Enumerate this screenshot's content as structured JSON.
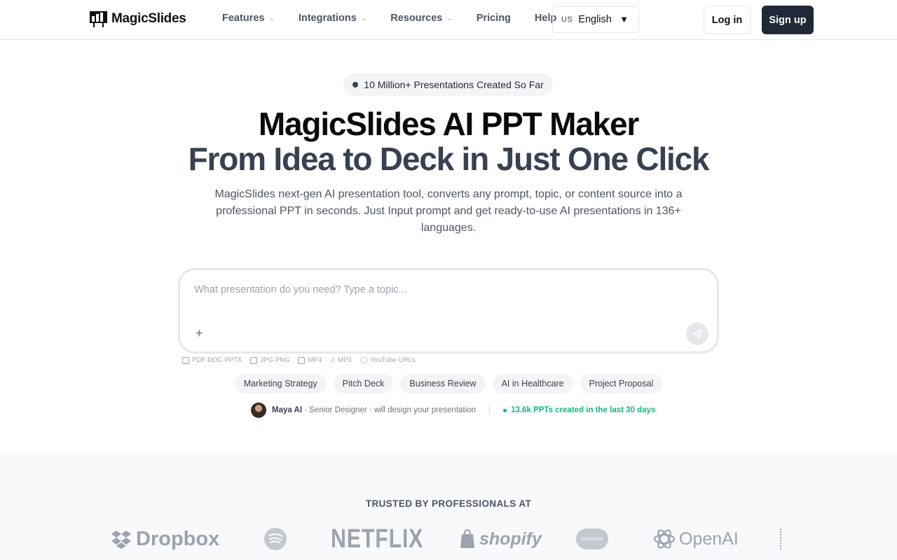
{
  "nav": {
    "brand": "MagicSlides",
    "links": [
      {
        "label": "Features",
        "has_menu": true
      },
      {
        "label": "Integrations",
        "has_menu": true
      },
      {
        "label": "Resources",
        "has_menu": true
      },
      {
        "label": "Pricing",
        "has_menu": false
      },
      {
        "label": "Help",
        "has_menu": false
      }
    ],
    "language": {
      "flag": "US",
      "label": "English"
    },
    "login": "Log in",
    "signup": "Sign up"
  },
  "hero": {
    "badge": "10 Million+ Presentations Created So Far",
    "title_line1": "MagicSlides AI PPT Maker",
    "title_line2": "From Idea to Deck in Just One Click",
    "subtitle": "MagicSlides next-gen AI presentation tool, converts any prompt, topic, or content source into a professional PPT in seconds. Just Input prompt and get ready-to-use AI presentations in 136+ languages."
  },
  "prompt": {
    "placeholder": "What presentation do you need? Type a topic...",
    "value": ""
  },
  "formats": [
    "PDF·DOC·PPTX",
    "JPG·PNG",
    "MP4",
    "MP3",
    "YouTube·URLs"
  ],
  "suggestions": [
    "Marketing Strategy",
    "Pitch Deck",
    "Business Review",
    "AI in Healthcare",
    "Project Proposal"
  ],
  "assistant": {
    "name": "Maya AI",
    "role": "· Senior Designer ·",
    "action": "will design your presentation",
    "stat": "13.6k PPTs created in the last 30 days"
  },
  "trusted": {
    "title": "TRUSTED BY PROFESSIONALS AT",
    "logos": [
      "Dropbox",
      "Spotify",
      "NETFLIX",
      "shopify",
      "salesforce",
      "OpenAI"
    ]
  },
  "colors": {
    "accent_dark": "#1f2937",
    "stat_green": "#10b981",
    "muted": "#9ca3af"
  }
}
